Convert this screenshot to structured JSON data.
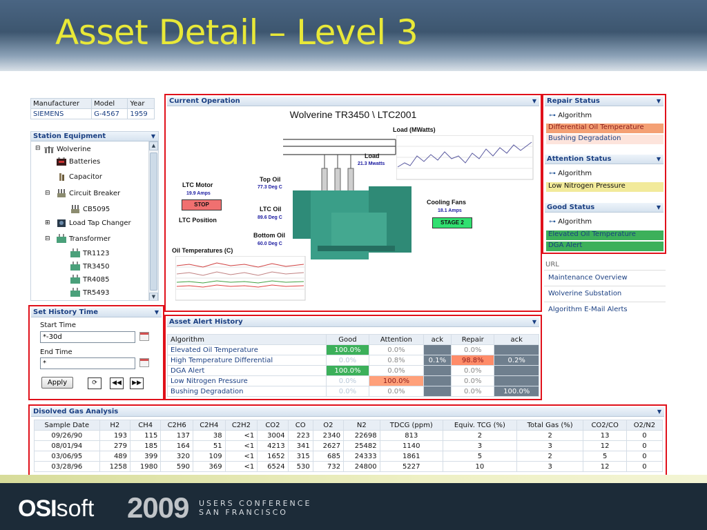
{
  "slide": {
    "title": "Asset Detail – Level 3"
  },
  "footer": {
    "brand_bold": "OSI",
    "brand_light": "soft",
    "year": "2009",
    "conf_line1": "USERS CONFERENCE",
    "conf_line2": "SAN FRANCISCO"
  },
  "asset": {
    "headers": [
      "Manufacturer",
      "Model",
      "Year"
    ],
    "values": [
      "SIEMENS",
      "G-4567",
      "1959"
    ]
  },
  "station": {
    "title": "Station Equipment",
    "items": [
      "Wolverine",
      "Batteries",
      "Capacitor",
      "Circuit Breaker",
      "CB5095",
      "Load Tap Changer",
      "Transformer",
      "TR1123",
      "TR3450",
      "TR4085",
      "TR5493"
    ]
  },
  "current": {
    "title": "Current Operation",
    "subtitle": "Wolverine TR3450 \\ LTC2001",
    "load_chart_title": "Load (MWatts)",
    "load_label": "Load",
    "load_value": "21.3 Mwatts",
    "top_oil_label": "Top Oil",
    "top_oil_value": "77.3 Deg C",
    "ltc_motor_label": "LTC Motor",
    "ltc_motor_value": "19.9 Amps",
    "stop": "STOP",
    "ltc_oil_label": "LTC Oil",
    "ltc_oil_value": "89.6 Deg C",
    "ltc_position": "LTC Position",
    "bottom_oil_label": "Bottom Oil",
    "bottom_oil_value": "60.0 Deg C",
    "fans_label": "Cooling Fans",
    "fans_value": "18.1 Amps",
    "stage": "STAGE 2",
    "oil_temp_title": "Oil Temperatures (C)"
  },
  "repair": {
    "title": "Repair Status",
    "algo": "Algorithm",
    "items": [
      "Differential Oil Temperature",
      "Bushing Degradation"
    ]
  },
  "attention": {
    "title": "Attention Status",
    "algo": "Algorithm",
    "items": [
      "Low Nitrogen Pressure"
    ]
  },
  "good": {
    "title": "Good Status",
    "algo": "Algorithm",
    "items": [
      "Elevated Oil Temperature",
      "DGA Alert"
    ]
  },
  "url": {
    "label": "URL",
    "links": [
      "Maintenance Overview",
      "Wolverine Substation",
      "Algorithm E-Mail Alerts"
    ]
  },
  "history": {
    "title": "Set History Time",
    "start_label": "Start Time",
    "start_value": "*-30d",
    "end_label": "End Time",
    "end_value": "*",
    "apply": "Apply"
  },
  "alerts": {
    "title": "Asset Alert History",
    "headers": [
      "Algorithm",
      "Good",
      "Attention",
      "ack",
      "Repair",
      "ack"
    ],
    "rows": [
      [
        "Elevated Oil Temperature",
        "100.0%",
        "0.0%",
        "",
        "0.0%",
        ""
      ],
      [
        "High Temperature Differential",
        "0.0%",
        "0.8%",
        "0.1%",
        "98.8%",
        "0.2%"
      ],
      [
        "DGA Alert",
        "100.0%",
        "0.0%",
        "",
        "0.0%",
        ""
      ],
      [
        "Low Nitrogen Pressure",
        "0.0%",
        "100.0%",
        "",
        "0.0%",
        ""
      ],
      [
        "Bushing Degradation",
        "0.0%",
        "0.0%",
        "",
        "0.0%",
        "100.0%"
      ]
    ]
  },
  "dga": {
    "title": "Disolved Gas Analysis",
    "headers": [
      "Sample Date",
      "H2",
      "CH4",
      "C2H6",
      "C2H4",
      "C2H2",
      "CO2",
      "CO",
      "O2",
      "N2",
      "TDCG (ppm)",
      "Equiv. TCG (%)",
      "Total Gas (%)",
      "CO2/CO",
      "O2/N2"
    ],
    "rows": [
      [
        "09/26/90",
        "193",
        "115",
        "137",
        "38",
        "<1",
        "3004",
        "223",
        "2340",
        "22698",
        "813",
        "2",
        "2",
        "13",
        "0"
      ],
      [
        "08/01/94",
        "279",
        "185",
        "164",
        "51",
        "<1",
        "4213",
        "341",
        "2627",
        "25482",
        "1140",
        "3",
        "3",
        "12",
        "0"
      ],
      [
        "03/06/95",
        "489",
        "399",
        "320",
        "109",
        "<1",
        "1652",
        "315",
        "685",
        "24333",
        "1861",
        "5",
        "2",
        "5",
        "0"
      ],
      [
        "03/28/96",
        "1258",
        "1980",
        "590",
        "369",
        "<1",
        "6524",
        "530",
        "732",
        "24800",
        "5227",
        "10",
        "3",
        "12",
        "0"
      ]
    ]
  },
  "colors": {
    "accent": "#1a3f82",
    "red_box": "#e0101a",
    "good": "#3cb05a",
    "attention": "#ffa07a",
    "repair": "#ff8c69",
    "ack": "#6f7f8e",
    "title_yellow": "#e8e838"
  }
}
